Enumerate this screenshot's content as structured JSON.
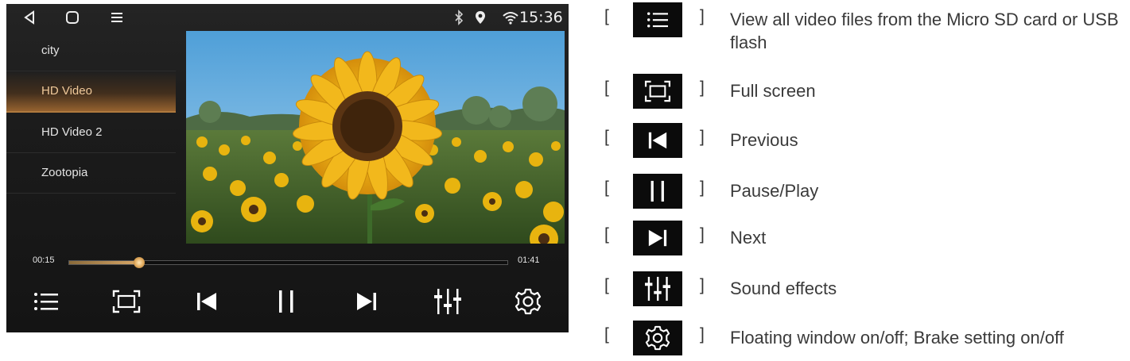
{
  "status_bar": {
    "time": "15:36"
  },
  "playlist": {
    "items": [
      {
        "label": "city",
        "active": false
      },
      {
        "label": "HD Video",
        "active": true
      },
      {
        "label": "HD Video 2",
        "active": false
      },
      {
        "label": "Zootopia",
        "active": false
      }
    ]
  },
  "player": {
    "elapsed": "00:15",
    "duration": "01:41",
    "progress_fraction": 0.16,
    "accent_color": "#d9a868"
  },
  "controls": [
    {
      "icon": "list-icon"
    },
    {
      "icon": "fullscreen-icon"
    },
    {
      "icon": "previous-icon"
    },
    {
      "icon": "pause-icon"
    },
    {
      "icon": "next-icon"
    },
    {
      "icon": "equalizer-icon"
    },
    {
      "icon": "settings-icon"
    }
  ],
  "legend": [
    {
      "icon": "list-icon",
      "description": "View all video files from the Micro SD card or USB flash"
    },
    {
      "icon": "fullscreen-icon",
      "description": "Full screen"
    },
    {
      "icon": "previous-icon",
      "description": "Previous"
    },
    {
      "icon": "pause-icon",
      "description": "Pause/Play"
    },
    {
      "icon": "next-icon",
      "description": "Next"
    },
    {
      "icon": "equalizer-icon",
      "description": "Sound effects"
    },
    {
      "icon": "settings-icon",
      "description": "Floating window on/off; Brake setting on/off"
    }
  ],
  "legend_brackets": {
    "open": "[",
    "close": "]"
  }
}
